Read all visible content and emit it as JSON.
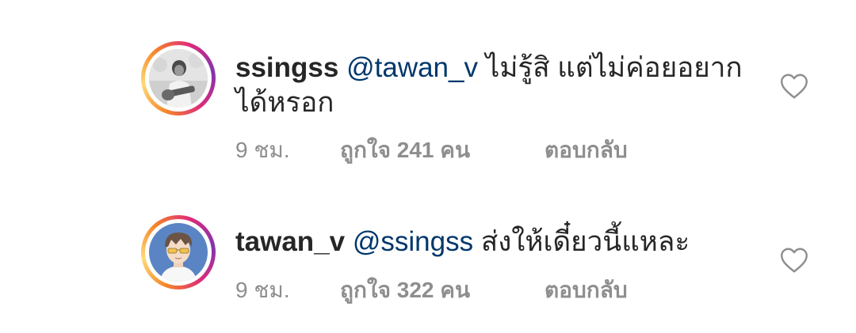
{
  "comments": [
    {
      "username": "ssingss",
      "mention": "@tawan_v",
      "text": "ไม่รู้สิ แต่ไม่ค่อยอยากได้หรอก",
      "time": "9 ชม.",
      "likes": "ถูกใจ 241 คน",
      "reply": "ตอบกลับ",
      "avatar": "guitar-player-photo",
      "like_icon": "heart-outline-icon"
    },
    {
      "username": "tawan_v",
      "mention": "@ssingss",
      "text": "ส่งให้เดี๋ยวนี้แหละ",
      "time": "9 ชม.",
      "likes": "ถูกใจ 322 คน",
      "reply": "ตอบกลับ",
      "avatar": "cartoon-boy-illustration",
      "like_icon": "heart-outline-icon"
    }
  ],
  "colors": {
    "mention": "#00376b",
    "meta": "#8e8e8e",
    "text": "#262626",
    "ring_start": "#f58529",
    "ring_end": "#dd2a7b"
  }
}
